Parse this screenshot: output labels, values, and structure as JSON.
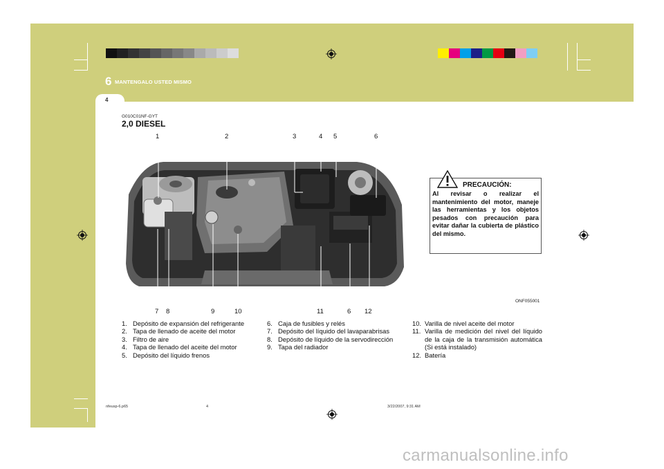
{
  "header": {
    "chapter_number": "6",
    "chapter_title": "MANTENGALO USTED MISMO",
    "page_number": "4"
  },
  "colors": {
    "page_band": "#cfcf7c",
    "gray_strip": [
      "#111111",
      "#222222",
      "#333333",
      "#444444",
      "#555555",
      "#666666",
      "#777777",
      "#888888",
      "#aaaaaa",
      "#bbbbbb",
      "#cccccc",
      "#dddddd"
    ],
    "color_strip": [
      "#ffef00",
      "#e6007e",
      "#00a0e9",
      "#1d2088",
      "#009944",
      "#e60012",
      "#231815",
      "#f19ec2",
      "#7ecef4",
      "#cfcf7c"
    ]
  },
  "section": {
    "code": "G010C01NF-GYT",
    "title": "2,0 DIESEL"
  },
  "figure": {
    "top_callouts": [
      "1",
      "2",
      "3",
      "4",
      "5",
      "6"
    ],
    "bottom_callouts": [
      "7",
      "8",
      "9",
      "10",
      "11",
      "6",
      "12"
    ],
    "image_code": "ONF055001"
  },
  "warning": {
    "icon": "exclamation-triangle-icon",
    "title": "PRECAUCIÓN:",
    "body": "Al revisar o realizar el mantenimiento del motor, maneje las herramientas y los objetos pesados con precaución para evitar dañar la cubierta de plástico del mismo."
  },
  "lists": {
    "col1": [
      {
        "n": "1.",
        "t": "Depósito de expansión del refrigerante"
      },
      {
        "n": "2.",
        "t": "Tapa de llenado de aceite del motor"
      },
      {
        "n": "3.",
        "t": "Filtro de aire"
      },
      {
        "n": "4.",
        "t": "Tapa de llenado del aceite del motor"
      },
      {
        "n": "5.",
        "t": "Depósito del líquido frenos"
      }
    ],
    "col2": [
      {
        "n": "6.",
        "t": "Caja de fusibles y relés"
      },
      {
        "n": "7.",
        "t": "Depósito del líquido del lavaparabrisas"
      },
      {
        "n": "8.",
        "t": "Depósito de líquido de la servodirección"
      },
      {
        "n": "9.",
        "t": "Tapa del radiador"
      }
    ],
    "col3": [
      {
        "n": "10.",
        "t": "Varilla de nivel aceite del motor"
      },
      {
        "n": "11.",
        "t": "Varilla de medición del nivel del líquido de la caja de la transmisión automática (Si está instalado)"
      },
      {
        "n": "12.",
        "t": "Batería"
      }
    ]
  },
  "footer": {
    "file": "nfeusp-6.p65",
    "page": "4",
    "date": "3/22/2007, 9:31 AM"
  },
  "watermark": "carmanualsonline.info"
}
